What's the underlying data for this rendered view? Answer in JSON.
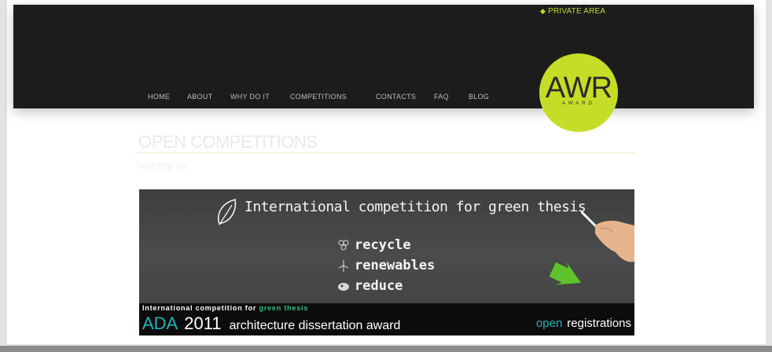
{
  "header": {
    "private_area": "PRIVATE AREA",
    "nav": [
      "HOME",
      "ABOUT",
      "WHY DO IT",
      "COMPETITIONS",
      "CONTACTS",
      "FAQ",
      "BLOG"
    ],
    "logo": {
      "main": "AWR",
      "sub": "AWARD"
    }
  },
  "main": {
    "section_title": "OPEN COMPETITIONS",
    "section_sub": "HOSTED BY",
    "banner": {
      "headline": "International competition for green thesis",
      "list": [
        "recycle",
        "renewables",
        "reduce"
      ],
      "tagline_prefix": "International competition for ",
      "tagline_green": "green thesis",
      "ada_code": "ADA",
      "ada_year": "2011",
      "ada_title": "architecture dissertation award",
      "open": "open",
      "registrations": "registrations"
    }
  },
  "colors": {
    "accent": "#c6dd28",
    "header_bg": "#1c1c1c",
    "teal": "#1fb3b8"
  }
}
